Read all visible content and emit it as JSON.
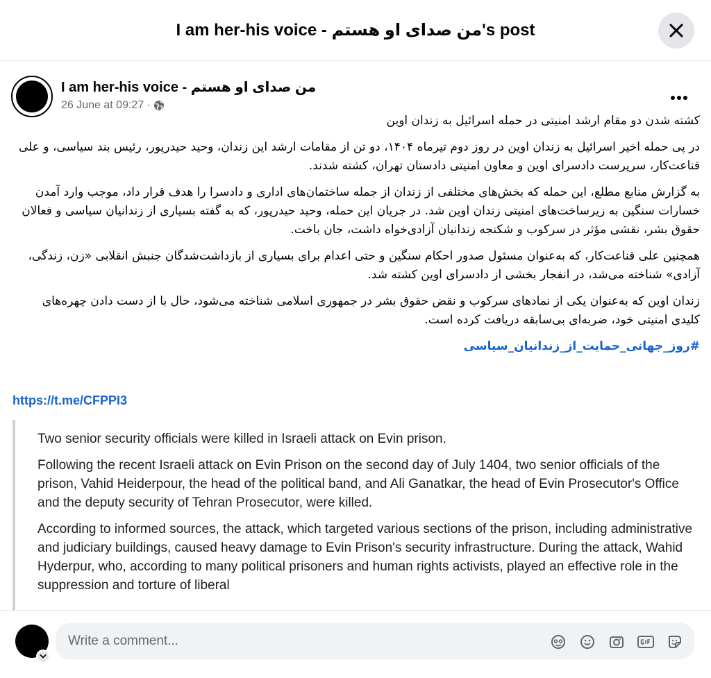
{
  "header": {
    "title": "I am her-his voice - من صدای او هستم's post"
  },
  "post": {
    "author": "I am her-his voice - من صدای او هستم",
    "timestamp": "26 June at 09:27",
    "separator": "·",
    "privacy_icon": "globe-icon",
    "more_icon": "more-dots-icon",
    "paragraphs_fa": [
      "کشته شدن دو مقام ارشد امنیتی در حمله اسرائیل به زندان اوین",
      "در پی حمله اخیر اسرائیل به زندان اوین در روز دوم تیرماه ۱۴۰۴، دو تن از مقامات ارشد این زندان، وحید حیدرپور، رئیس بند سیاسی، و علی قناعت‌کار، سرپرست دادسرای اوین و معاون امنیتی دادستان تهران، کشته شدند.",
      "به گزارش منابع مطلع، این حمله که بخش‌های مختلفی از زندان از جمله ساختمان‌های اداری و دادسرا را هدف قرار داد، موجب وارد آمدن خسارات سنگین به زیرساخت‌های امنیتی زندان اوین شد. در جریان این حمله، وحید حیدرپور، که به گفته بسیاری از زندانیان سیاسی و فعالان حقوق بشر، نقشی مؤثر در سرکوب و شکنجه زندانیان آزادی‌خواه داشت، جان باخت.",
      "همچنین علی قناعت‌کار، که به‌عنوان مسئول صدور احکام سنگین و حتی اعدام برای بسیاری از بازداشت‌شدگان جنبش انقلابی «زن، زندگی، آزادی» شناخته می‌شد، در انفجار بخشی از دادسرای اوین کشته شد.",
      "زندان اوین که به‌عنوان یکی از نمادهای سرکوب و نقض حقوق بشر در جمهوری اسلامی شناخته می‌شود، حال با از دست دادن چهره‌های کلیدی امنیتی خود، ضربه‌ای بی‌سابقه دریافت کرده است."
    ],
    "hashtag": "#روز_جهانی_حمایت_از_زندانیان_سیاسی",
    "link": "https://t.me/CFPPI3",
    "paragraphs_en": [
      "Two senior security officials were killed in Israeli attack on Evin prison.",
      "Following the recent Israeli attack on Evin Prison on the second day of July 1404, two senior officials of the prison, Vahid Heiderpour, the head of the political band, and Ali Ganatkar, the head of Evin Prosecutor's Office and the deputy security of Tehran Prosecutor, were killed.",
      "According to informed sources, the attack, which targeted various sections of the prison, including administrative and judiciary buildings, caused heavy damage to Evin Prison's security infrastructure. During the attack, Wahid Hyderpur, who, according to many political prisoners and human rights activists, played an effective role in the suppression and torture of liberal"
    ]
  },
  "comment_bar": {
    "placeholder": "Write a comment...",
    "icons": [
      "avatar-sticker-icon",
      "emoji-icon",
      "camera-icon",
      "gif-icon",
      "sticker-icon"
    ]
  },
  "colors": {
    "link": "#1763cf",
    "muted": "#65676b",
    "input_bg": "#f0f2f5",
    "close_bg": "#e4e6eb"
  }
}
